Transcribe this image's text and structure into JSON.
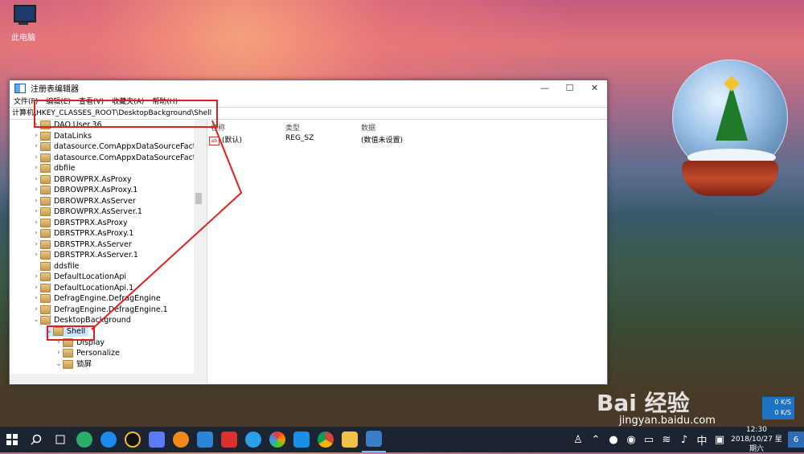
{
  "desktop": {
    "icon_label": "此电脑"
  },
  "window": {
    "title": "注册表编辑器",
    "controls": {
      "minimize": "—",
      "maximize": "☐",
      "close": "✕"
    },
    "menu": [
      "文件(F)",
      "编辑(E)",
      "查看(V)",
      "收藏夹(A)",
      "帮助(H)"
    ],
    "address": "计算机\\HKEY_CLASSES_ROOT\\DesktopBackground\\Shell"
  },
  "tree": {
    "items": [
      {
        "label": "DAO.User.36",
        "chev": "›"
      },
      {
        "label": "DataLinks",
        "chev": "›"
      },
      {
        "label": "datasource.ComAppxDataSourceFacto",
        "chev": "›"
      },
      {
        "label": "datasource.ComAppxDataSourceFacto",
        "chev": "›"
      },
      {
        "label": "dbfile",
        "chev": "›"
      },
      {
        "label": "DBROWPRX.AsProxy",
        "chev": "›"
      },
      {
        "label": "DBROWPRX.AsProxy.1",
        "chev": "›"
      },
      {
        "label": "DBROWPRX.AsServer",
        "chev": "›"
      },
      {
        "label": "DBROWPRX.AsServer.1",
        "chev": "›"
      },
      {
        "label": "DBRSTPRX.AsProxy",
        "chev": "›"
      },
      {
        "label": "DBRSTPRX.AsProxy.1",
        "chev": "›"
      },
      {
        "label": "DBRSTPRX.AsServer",
        "chev": "›"
      },
      {
        "label": "DBRSTPRX.AsServer.1",
        "chev": "›"
      },
      {
        "label": "ddsfile",
        "chev": ""
      },
      {
        "label": "DefaultLocationApi",
        "chev": "›"
      },
      {
        "label": "DefaultLocationApi.1",
        "chev": "›"
      },
      {
        "label": "DefragEngine.DefragEngine",
        "chev": "›"
      },
      {
        "label": "DefragEngine.DefragEngine.1",
        "chev": "›"
      },
      {
        "label": "DesktopBackground",
        "chev": "⌄"
      },
      {
        "label": "Shell",
        "chev": "⌄"
      },
      {
        "label": "Display",
        "chev": "›"
      },
      {
        "label": "Personalize",
        "chev": "›"
      },
      {
        "label": "锁屏",
        "chev": "⌄"
      }
    ]
  },
  "list": {
    "headers": {
      "name": "名称",
      "type": "类型",
      "data": "数据"
    },
    "rows": [
      {
        "name": "(默认)",
        "type": "REG_SZ",
        "data": "(数值未设置)",
        "icon": "ab"
      }
    ]
  },
  "watermark": {
    "main": "Bai 经验",
    "sub": "jingyan.baidu.com"
  },
  "net_widget": {
    "up": "0 K/S",
    "down": "0 K/S"
  },
  "taskbar": {
    "tray_lang": "中",
    "time": "12:30",
    "date": "2018/10/27 星期六",
    "notification_count": "6"
  },
  "colors": {
    "annotation_red": "#e02020",
    "taskbar_bg": "#1b2430",
    "selection": "#cce8ff"
  }
}
